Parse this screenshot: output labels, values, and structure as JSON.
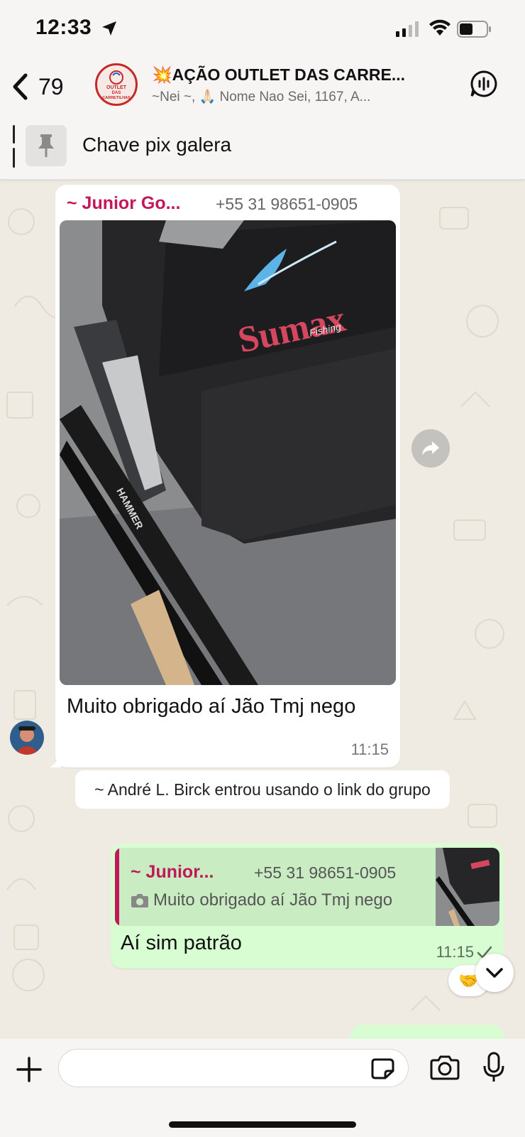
{
  "status_bar": {
    "time": "12:33"
  },
  "header": {
    "back_count": "79",
    "title": "💥AÇÃO OUTLET DAS CARRE...",
    "subtitle": "~Nei ~, 🙏🏻 Nome Nao Sei, 1167, A...",
    "avatar_text": [
      "OUTLET",
      "DAS",
      "CARRETILHAS"
    ]
  },
  "pinned": {
    "text": "Chave pix galera"
  },
  "messages": {
    "incoming": {
      "sender": "~ Junior Go...",
      "phone": "+55 31 98651-0905",
      "caption": "Muito obrigado aí Jão Tmj nego",
      "time": "11:15",
      "photo_brand": "Sumax",
      "photo_brand_sub": "Fishing",
      "rod_label": "HAMMER"
    },
    "system": "~ André L. Birck entrou usando o link do grupo",
    "outgoing": {
      "quote_sender": "~ Junior...",
      "quote_phone": "+55 31 98651-0905",
      "quote_text": "Muito obrigado aí Jão Tmj nego",
      "text": "Aí sim patrão",
      "time": "11:15",
      "reaction": "🤝"
    }
  },
  "colors": {
    "accent_name": "#c2185b",
    "outgoing_bubble": "#d9fdd3",
    "chat_background": "#efeae2"
  },
  "icons": [
    "location-arrow-icon",
    "signal-icon",
    "wifi-icon",
    "battery-icon",
    "back-chevron-icon",
    "voice-chat-icon",
    "pin-icon",
    "forward-icon",
    "camera-small-icon",
    "check-icon",
    "chevron-down-icon",
    "plus-icon",
    "sticker-icon",
    "camera-icon",
    "mic-icon"
  ]
}
